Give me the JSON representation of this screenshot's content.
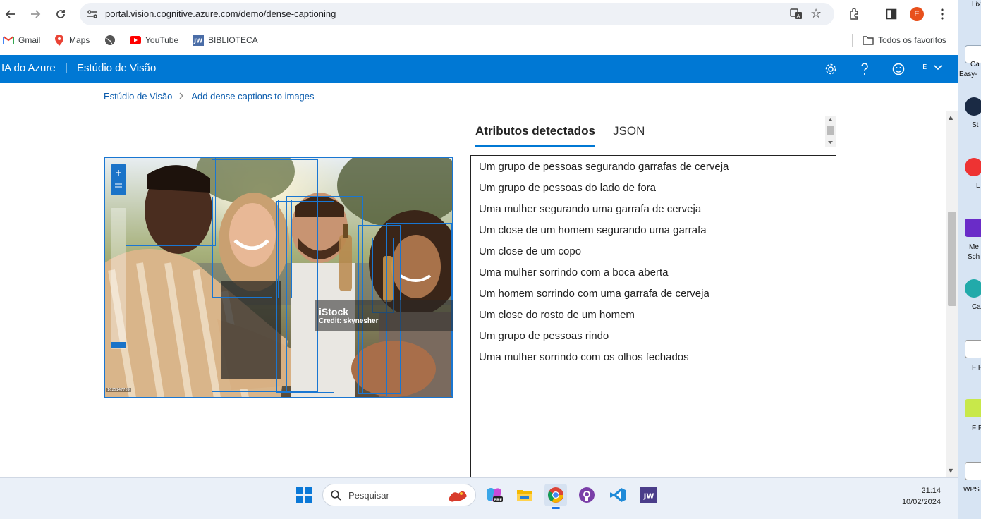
{
  "browser": {
    "url": "portal.vision.cognitive.azure.com/demo/dense-captioning",
    "profile_initial": "E",
    "bookmarks": [
      "Gmail",
      "Maps",
      "YouTube",
      "BIBLIOTECA"
    ],
    "all_bookmarks": "Todos os favoritos"
  },
  "azure": {
    "brand": "IA do Azure",
    "divider": "|",
    "product": "Estúdio de Visão",
    "user_initial": "E"
  },
  "breadcrumb": {
    "root": "Estúdio de Visão",
    "separator": ">",
    "current": "Add dense captions to images"
  },
  "image": {
    "watermark_brand": "iStock",
    "watermark_credit": "Credit: skynesher",
    "image_id": "1625147789"
  },
  "tabs": [
    "Atributos detectados",
    "JSON"
  ],
  "captions": [
    "Um grupo de pessoas segurando garrafas de cerveja",
    "Um grupo de pessoas do lado de fora",
    "Uma mulher segurando uma garrafa de cerveja",
    "Um close de um homem segurando uma garrafa",
    "Um close de um copo",
    "Uma mulher sorrindo com a boca aberta",
    "Um homem sorrindo com uma garrafa de cerveja",
    "Um close do rosto de um homem",
    "Um grupo de pessoas rindo",
    "Uma mulher sorrindo com os olhos fechados"
  ],
  "taskbar": {
    "search_placeholder": "Pesquisar",
    "time": "21:14",
    "date": "10/02/2024"
  },
  "desktop": {
    "labels": [
      "Lix",
      "Ca",
      "Easy-",
      "St",
      "L",
      "Me",
      "Sch",
      "Ca",
      "FIF",
      "FIF",
      "WPS"
    ]
  },
  "colors": {
    "azure_blue": "#0078d4",
    "bbox_blue": "#1976d2",
    "link_blue": "#0b5cad"
  }
}
